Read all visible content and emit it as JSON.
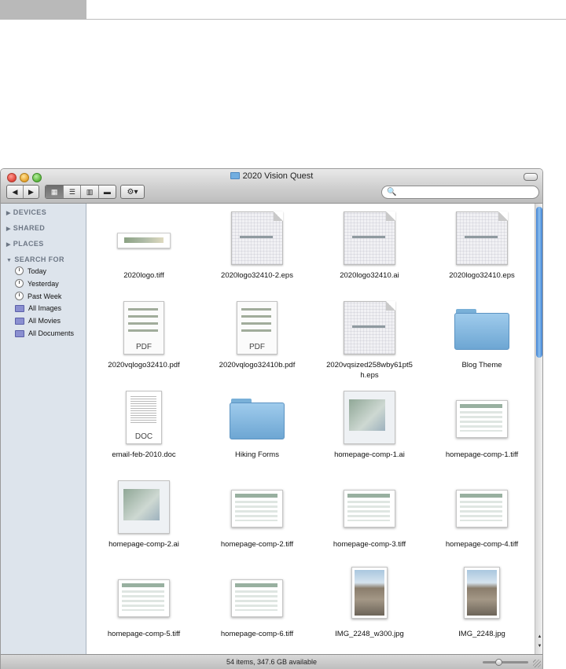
{
  "window": {
    "title": "2020 Vision Quest",
    "nav": {
      "back": "◀",
      "forward": "▶"
    },
    "view_buttons": [
      {
        "name": "icon-view",
        "glyph": "▦",
        "active": true
      },
      {
        "name": "list-view",
        "glyph": "☰",
        "active": false
      },
      {
        "name": "column-view",
        "glyph": "▥",
        "active": false
      },
      {
        "name": "coverflow-view",
        "glyph": "▬",
        "active": false
      }
    ],
    "action_glyph": "⚙▾",
    "search": {
      "icon": "🔍",
      "value": ""
    }
  },
  "sidebar": {
    "sections": [
      {
        "label": "DEVICES",
        "expanded": false
      },
      {
        "label": "SHARED",
        "expanded": false
      },
      {
        "label": "PLACES",
        "expanded": false
      },
      {
        "label": "SEARCH FOR",
        "expanded": true
      }
    ],
    "search_items": [
      {
        "label": "Today",
        "icon": "clock-icon"
      },
      {
        "label": "Yesterday",
        "icon": "clock-icon"
      },
      {
        "label": "Past Week",
        "icon": "clock-icon"
      },
      {
        "label": "All Images",
        "icon": "smart-folder-icon"
      },
      {
        "label": "All Movies",
        "icon": "smart-folder-icon"
      },
      {
        "label": "All Documents",
        "icon": "smart-folder-icon"
      }
    ]
  },
  "files": [
    {
      "name": "2020logo.tiff",
      "kind": "wide"
    },
    {
      "name": "2020logo32410-2.eps",
      "kind": "doc"
    },
    {
      "name": "2020logo32410.ai",
      "kind": "doc"
    },
    {
      "name": "2020logo32410.eps",
      "kind": "doc"
    },
    {
      "name": "2020vqlogo32410.pdf",
      "kind": "pdf",
      "badge": "PDF"
    },
    {
      "name": "2020vqlogo32410b.pdf",
      "kind": "pdf",
      "badge": "PDF"
    },
    {
      "name": "2020vqsized258wby61pt5\nh.eps",
      "kind": "doc"
    },
    {
      "name": "Blog Theme",
      "kind": "folder"
    },
    {
      "name": "email-feb-2010.doc",
      "kind": "textdoc",
      "badge": "DOC"
    },
    {
      "name": "Hiking Forms",
      "kind": "folder"
    },
    {
      "name": "homepage-comp-1.ai",
      "kind": "aicomp"
    },
    {
      "name": "homepage-comp-1.tiff",
      "kind": "page"
    },
    {
      "name": "homepage-comp-2.ai",
      "kind": "aicomp"
    },
    {
      "name": "homepage-comp-2.tiff",
      "kind": "page"
    },
    {
      "name": "homepage-comp-3.tiff",
      "kind": "page"
    },
    {
      "name": "homepage-comp-4.tiff",
      "kind": "page"
    },
    {
      "name": "homepage-comp-5.tiff",
      "kind": "page"
    },
    {
      "name": "homepage-comp-6.tiff",
      "kind": "page"
    },
    {
      "name": "IMG_2248_w300.jpg",
      "kind": "photo"
    },
    {
      "name": "IMG_2248.jpg",
      "kind": "photo"
    }
  ],
  "scroll": {
    "position_fraction": 0.0
  },
  "statusbar": {
    "text": "54 items, 347.6 GB available",
    "icon_size_fraction": 0.35
  }
}
